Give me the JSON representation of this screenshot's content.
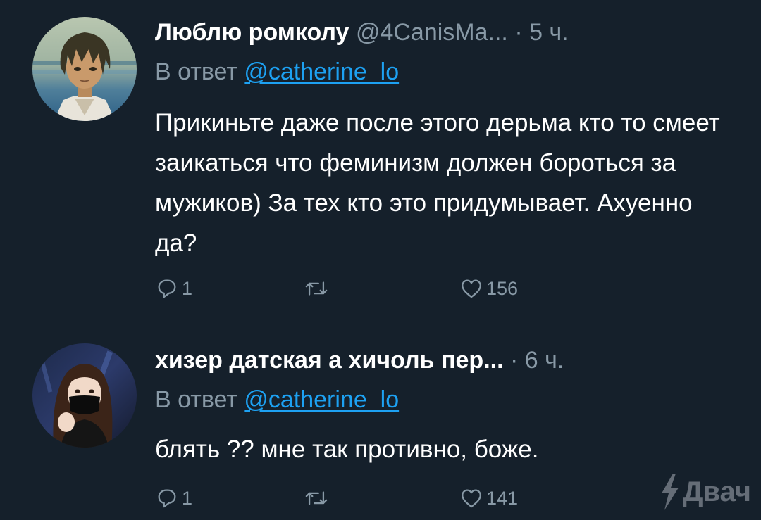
{
  "tweets": [
    {
      "display_name": "Люблю ромколу",
      "handle": "@4CanisMa...",
      "separator": "·",
      "time": "5 ч.",
      "reply_prefix": "В ответ",
      "reply_to": "@catherine_lo",
      "text": "Прикиньте даже после этого дерьма кто то смеет заикаться что феминизм должен бороться за мужиков) За тех кто это придумывает. Ахуенно да?",
      "actions": {
        "reply_icon": "reply-icon",
        "reply_count": "1",
        "retweet_icon": "retweet-icon",
        "retweet_count": "",
        "like_icon": "heart-icon",
        "like_count": "156"
      }
    },
    {
      "display_name": "хизер датская а хичоль пер...",
      "handle": "",
      "separator": "·",
      "time": "6 ч.",
      "reply_prefix": "В ответ",
      "reply_to": "@catherine_lo",
      "text": "блять ?? мне так противно, боже.",
      "actions": {
        "reply_icon": "reply-icon",
        "reply_count": "1",
        "retweet_icon": "retweet-icon",
        "retweet_count": "",
        "like_icon": "heart-icon",
        "like_count": "141"
      }
    }
  ],
  "watermark": "Двач",
  "colors": {
    "background": "#15202b",
    "primary_text": "#ffffff",
    "secondary_text": "#8899a6",
    "accent": "#1da1f2"
  }
}
